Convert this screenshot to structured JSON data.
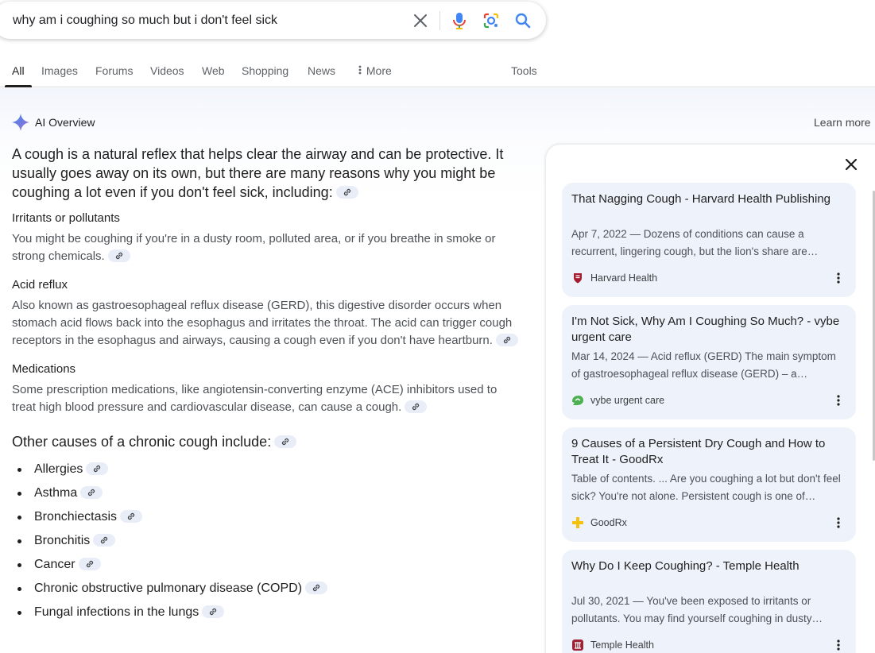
{
  "search": {
    "query": "why am i coughing so much but i don't feel sick",
    "icons": [
      "close-icon",
      "microphone-icon",
      "google-lens-icon",
      "search-icon"
    ]
  },
  "tabs": [
    {
      "label": "All",
      "active": true
    },
    {
      "label": "Images"
    },
    {
      "label": "Forums"
    },
    {
      "label": "Videos"
    },
    {
      "label": "Web"
    },
    {
      "label": "Shopping"
    },
    {
      "label": "News"
    },
    {
      "label": "More"
    }
  ],
  "tools_label": "Tools",
  "ai_overview": {
    "title": "AI Overview",
    "learn_more": "Learn more",
    "intro": "A cough is a natural reflex that helps clear the airway and can be protective. It usually goes away on its own, but there are many reasons why you might be coughing a lot even if you don't feel sick, including:",
    "sections": [
      {
        "heading": "Irritants or pollutants",
        "text": "You might be coughing if you're in a dusty room, polluted area, or if you breathe in smoke or strong chemicals."
      },
      {
        "heading": "Acid reflux",
        "text": "Also known as gastroesophageal reflux disease (GERD), this digestive disorder occurs when stomach acid flows back into the esophagus and irritates the throat. The acid can trigger cough receptors in the esophagus and airways, causing a cough even if you don't have heartburn."
      },
      {
        "heading": "Medications",
        "text": "Some prescription medications, like angiotensin-converting enzyme (ACE) inhibitors used to treat high blood pressure and cardiovascular disease, can cause a cough."
      }
    ],
    "other_heading": "Other causes of a chronic cough include:",
    "causes": [
      "Allergies",
      "Asthma",
      "Bronchiectasis",
      "Bronchitis",
      "Cancer",
      "Chronic obstructive pulmonary disease (COPD)",
      "Fungal infections in the lungs"
    ]
  },
  "sources": [
    {
      "title": "That Nagging Cough - Harvard Health Publishing",
      "snippet": "Apr 7, 2022 — Dozens of conditions can cause a recurrent, lingering cough, but the lion's share are…",
      "source": "Harvard Health",
      "logo_color": "#a51c30"
    },
    {
      "title": "I'm Not Sick, Why Am I Coughing So Much? - vybe urgent care",
      "snippet": "Mar 14, 2024 — Acid reflux (GERD) The main symptom of gastroesophageal reflux disease (GERD) – a…",
      "source": "vybe urgent care",
      "logo_color": "#4caf50"
    },
    {
      "title": "9 Causes of a Persistent Dry Cough and How to Treat It - GoodRx",
      "snippet": "Table of contents. ... Are you coughing a lot but don't feel sick? You're not alone. Persistent cough is one of…",
      "source": "GoodRx",
      "logo_color": "#f4c20d"
    },
    {
      "title": "Why Do I Keep Coughing? - Temple Health",
      "snippet": "Jul 30, 2021 — You've been exposed to irritants or pollutants. You may find yourself coughing in dusty…",
      "source": "Temple Health",
      "logo_color": "#9d2235"
    }
  ]
}
